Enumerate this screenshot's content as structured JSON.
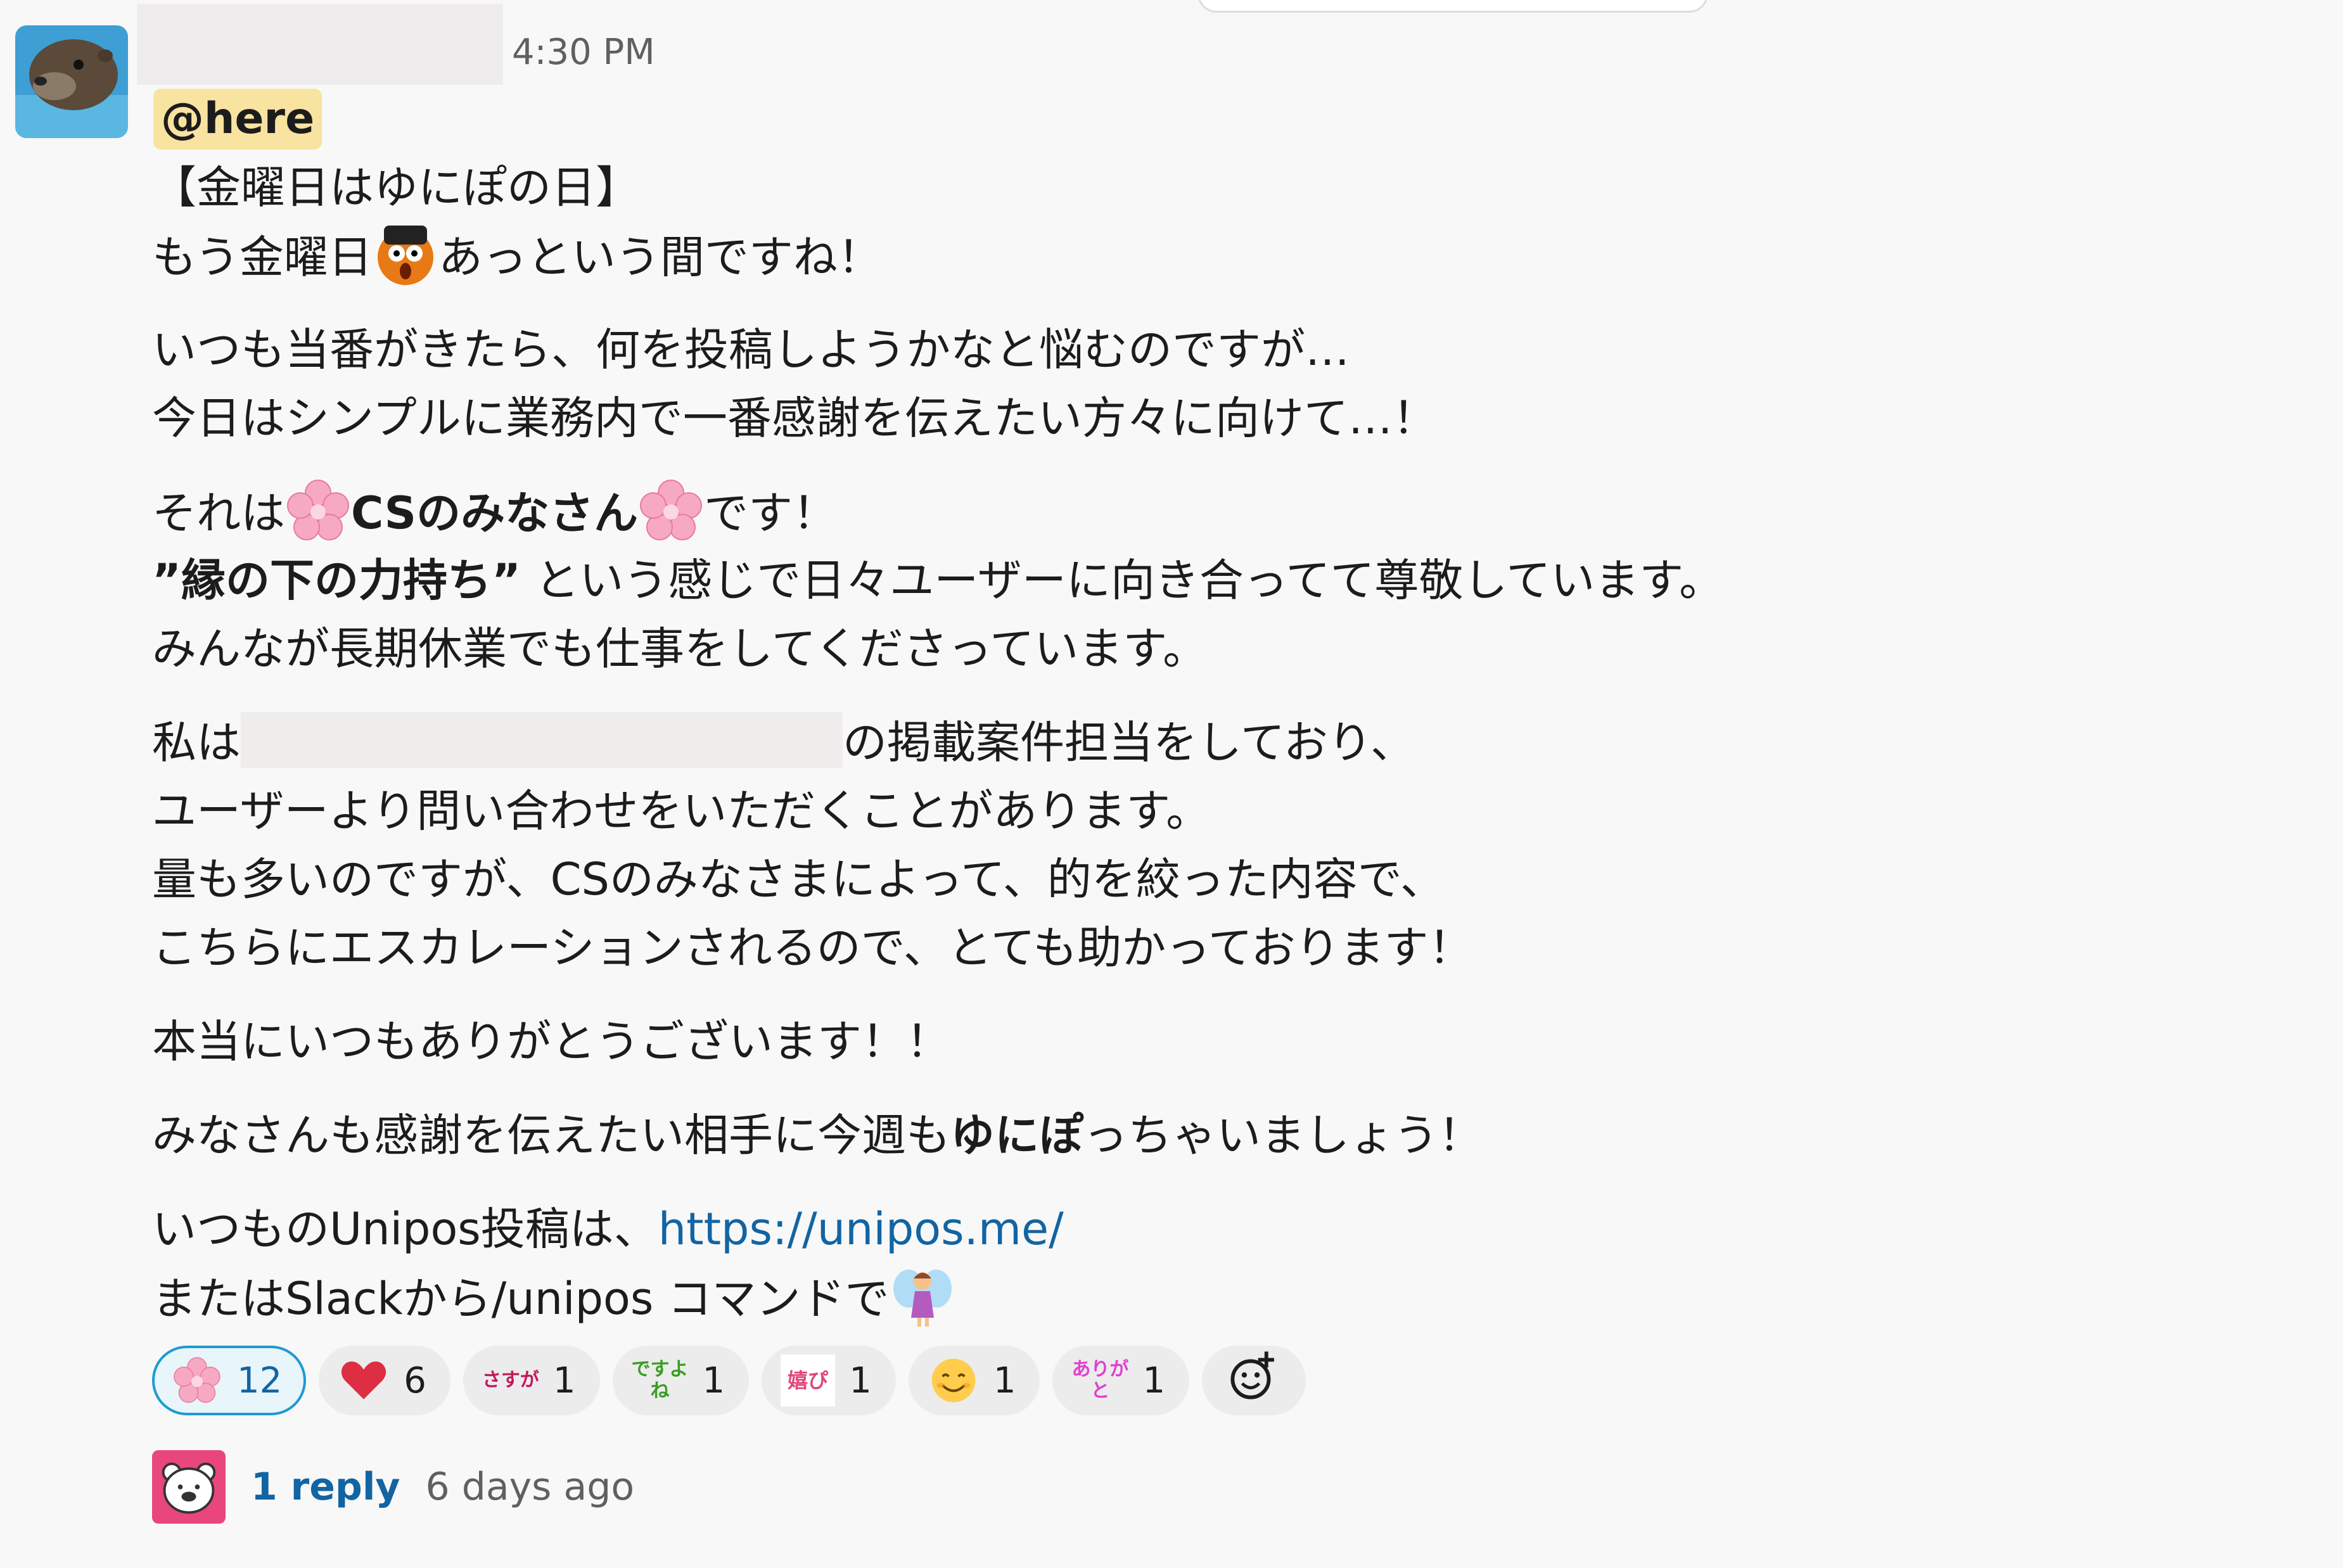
{
  "message": {
    "timestamp": "4:30 PM",
    "mention": "@here",
    "lines": {
      "l1": "【金曜日はゆにぽの日】",
      "l2a": "もう金曜日",
      "l2b": "あっという間ですね！",
      "l3": "いつも当番がきたら、何を投稿しようかなと悩むのですが…",
      "l4": "今日はシンプルに業務内で一番感謝を伝えたい方々に向けて…！",
      "l5a": "それは",
      "l5b": "CSのみなさん",
      "l5c": "です！",
      "l6a": "”縁の下の力持ち”",
      "l6b": " という感じで日々ユーザーに向き合ってて尊敬しています。",
      "l7": "みんなが長期休業でも仕事をしてくださっています。",
      "l8a": "私は",
      "l8b": "の掲載案件担当をしており、",
      "l9": "ユーザーより問い合わせをいただくことがあります。",
      "l10": "量も多いのですが、CSのみなさまによって、的を絞った内容で、",
      "l11": "こちらにエスカレーションされるので、とても助かっております！",
      "l12": "本当にいつもありがとうございます！！",
      "l13a": "みなさんも感謝を伝えたい相手に今週も",
      "l13b": "ゆにぽ",
      "l13c": "っちゃいましょう！",
      "l14a": "いつものUnipos投稿は、",
      "l14link": "https://unipos.me/",
      "l15": "またはSlackから/unipos コマンドで"
    }
  },
  "reactions": [
    {
      "emoji": "cherry-blossom-icon",
      "count": "12",
      "active": true
    },
    {
      "emoji": "red-heart-icon",
      "count": "6"
    },
    {
      "emoji_text": "さすが",
      "count": "1"
    },
    {
      "emoji_text": "ですよね",
      "count": "1"
    },
    {
      "emoji_text": "嬉ぴ",
      "count": "1"
    },
    {
      "emoji": "smiling-face-icon",
      "count": "1"
    },
    {
      "emoji_text": "ありがと",
      "count": "1"
    }
  ],
  "thread": {
    "reply_label": "1 reply",
    "time": "6 days ago"
  },
  "colors": {
    "link": "#1264a3",
    "mention_bg": "#f8e3a0",
    "active_reaction_border": "#1d9bd1",
    "thread_avatar": "#e8467c"
  }
}
